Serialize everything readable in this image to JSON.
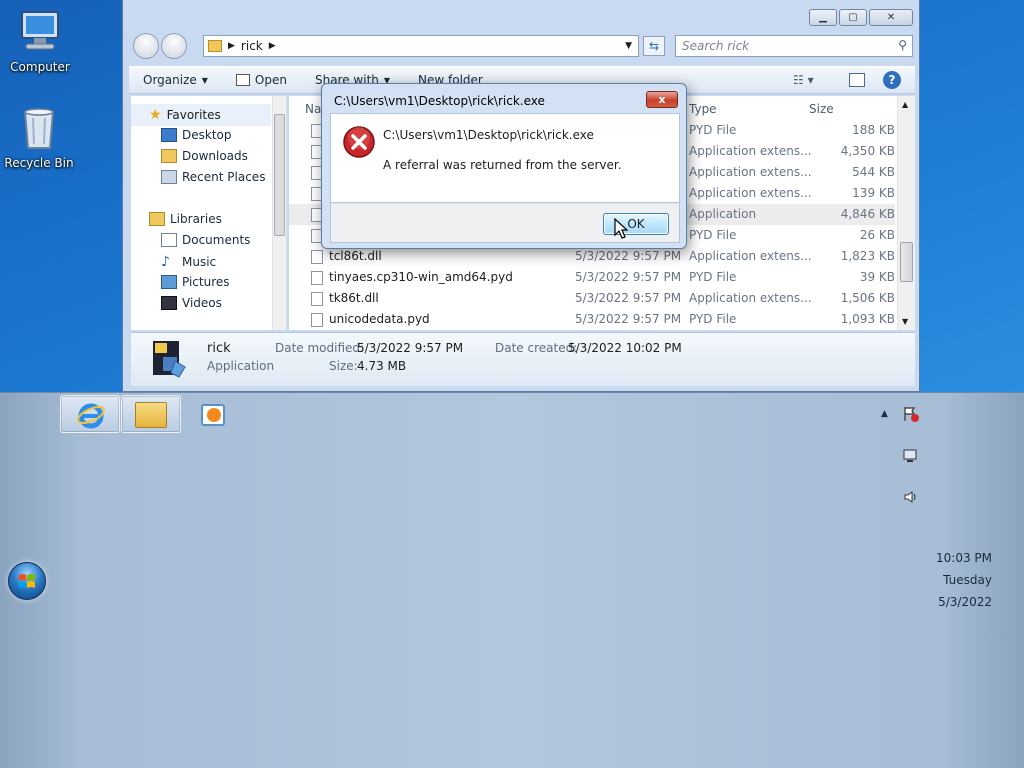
{
  "desktop": {
    "icons": [
      {
        "label": "Computer"
      },
      {
        "label": "Recycle Bin"
      }
    ]
  },
  "explorer": {
    "address": {
      "crumb": "rick"
    },
    "search": {
      "placeholder": "Search rick"
    },
    "toolbar": {
      "organize": "Organize",
      "open": "Open",
      "share_with": "Share with",
      "new_folder": "New folder"
    },
    "nav": {
      "favorites": "Favorites",
      "desktop": "Desktop",
      "downloads": "Downloads",
      "recent_places": "Recent Places",
      "libraries": "Libraries",
      "documents": "Documents",
      "music": "Music",
      "pictures": "Pictures",
      "videos": "Videos"
    },
    "columns": {
      "name": "Na",
      "type": "Type",
      "size": "Size"
    },
    "files": [
      {
        "name": "",
        "date": "",
        "type": "PYD File",
        "size": "188 KB"
      },
      {
        "name": "",
        "date": "",
        "type": "Application extens...",
        "size": "4,350 KB"
      },
      {
        "name": "",
        "date": "",
        "type": "Application extens...",
        "size": "544 KB"
      },
      {
        "name": "",
        "date": "",
        "type": "Application extens...",
        "size": "139 KB"
      },
      {
        "name": "",
        "date": "",
        "type": "Application",
        "size": "4,846 KB"
      },
      {
        "name": "",
        "date": "",
        "type": "PYD File",
        "size": "26 KB"
      },
      {
        "name": "tcl86t.dll",
        "date": "5/3/2022 9:57 PM",
        "type": "Application extens...",
        "size": "1,823 KB"
      },
      {
        "name": "tinyaes.cp310-win_amd64.pyd",
        "date": "5/3/2022 9:57 PM",
        "type": "PYD File",
        "size": "39 KB"
      },
      {
        "name": "tk86t.dll",
        "date": "5/3/2022 9:57 PM",
        "type": "Application extens...",
        "size": "1,506 KB"
      },
      {
        "name": "unicodedata.pyd",
        "date": "5/3/2022 9:57 PM",
        "type": "PYD File",
        "size": "1,093 KB"
      }
    ],
    "details": {
      "name": "rick",
      "kind": "Application",
      "date_modified_label": "Date modified:",
      "date_modified": "5/3/2022 9:57 PM",
      "date_created_label": "Date created:",
      "date_created": "5/3/2022 10:02 PM",
      "size_label": "Size:",
      "size": "4.73 MB"
    }
  },
  "dialog": {
    "title": "C:\\Users\\vm1\\Desktop\\rick\\rick.exe",
    "path": "C:\\Users\\vm1\\Desktop\\rick\\rick.exe",
    "message": "A referral was returned from the server.",
    "ok_label": "OK",
    "close_label": "x"
  },
  "taskbar": {
    "clock": {
      "time": "10:03 PM",
      "day": "Tuesday",
      "date": "5/3/2022"
    }
  },
  "icons": {
    "computer": "computer-icon",
    "recycle_bin": "recycle-bin-icon",
    "error": "error-icon",
    "ie": "internet-explorer-icon",
    "explorer": "file-explorer-icon",
    "media": "media-player-icon",
    "start": "start-orb-icon"
  },
  "colors": {
    "desktop_bg": "#1a73cc",
    "taskbar_bg": "#b2c6dc",
    "error_red": "#c8262a",
    "selection": "#d7e7f7"
  }
}
